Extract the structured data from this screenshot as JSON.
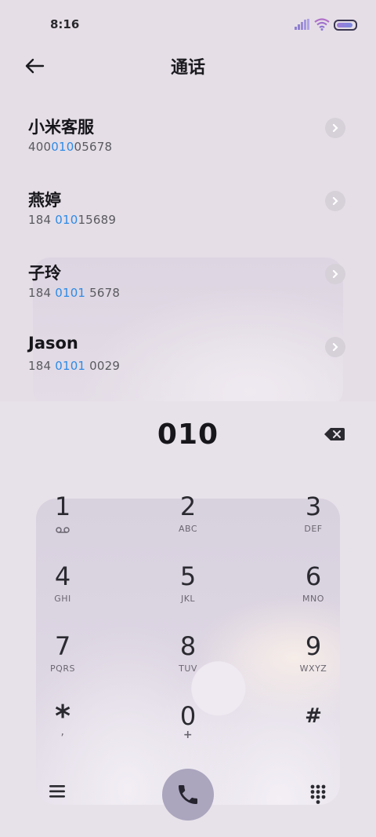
{
  "status": {
    "time": "8:16"
  },
  "header": {
    "title": "通话"
  },
  "contacts": [
    {
      "name": "小米客服",
      "num_pre": "400",
      "num_hl": "010",
      "num_post": "05678"
    },
    {
      "name": "燕婷",
      "num_pre": "184 ",
      "num_hl": "010",
      "num_post": "15689"
    },
    {
      "name": "子玲",
      "num_pre": "184 ",
      "num_hl": "0101",
      "num_post": " 5678"
    },
    {
      "name": "Jason",
      "num_pre": "184 ",
      "num_hl": "0101",
      "num_post": " 0029"
    }
  ],
  "dialer": {
    "digits": "010",
    "keys": [
      {
        "n": "1",
        "l": ""
      },
      {
        "n": "2",
        "l": "ABC"
      },
      {
        "n": "3",
        "l": "DEF"
      },
      {
        "n": "4",
        "l": "GHI"
      },
      {
        "n": "5",
        "l": "JKL"
      },
      {
        "n": "6",
        "l": "MNO"
      },
      {
        "n": "7",
        "l": "PQRS"
      },
      {
        "n": "8",
        "l": "TUV"
      },
      {
        "n": "9",
        "l": "WXYZ"
      },
      {
        "n": "*",
        "l": ","
      },
      {
        "n": "0",
        "l": "+"
      },
      {
        "n": "#",
        "l": ""
      }
    ]
  },
  "icons": {
    "key1_sub": "voicemail-icon",
    "back": "arrow-left-icon",
    "backspace": "backspace-icon",
    "menu": "menu-icon",
    "call": "phone-icon",
    "keypad": "dialpad-icon"
  },
  "colors": {
    "highlight": "#2e8ae6",
    "call_button": "#aba5be",
    "background": "#e5dee7"
  }
}
